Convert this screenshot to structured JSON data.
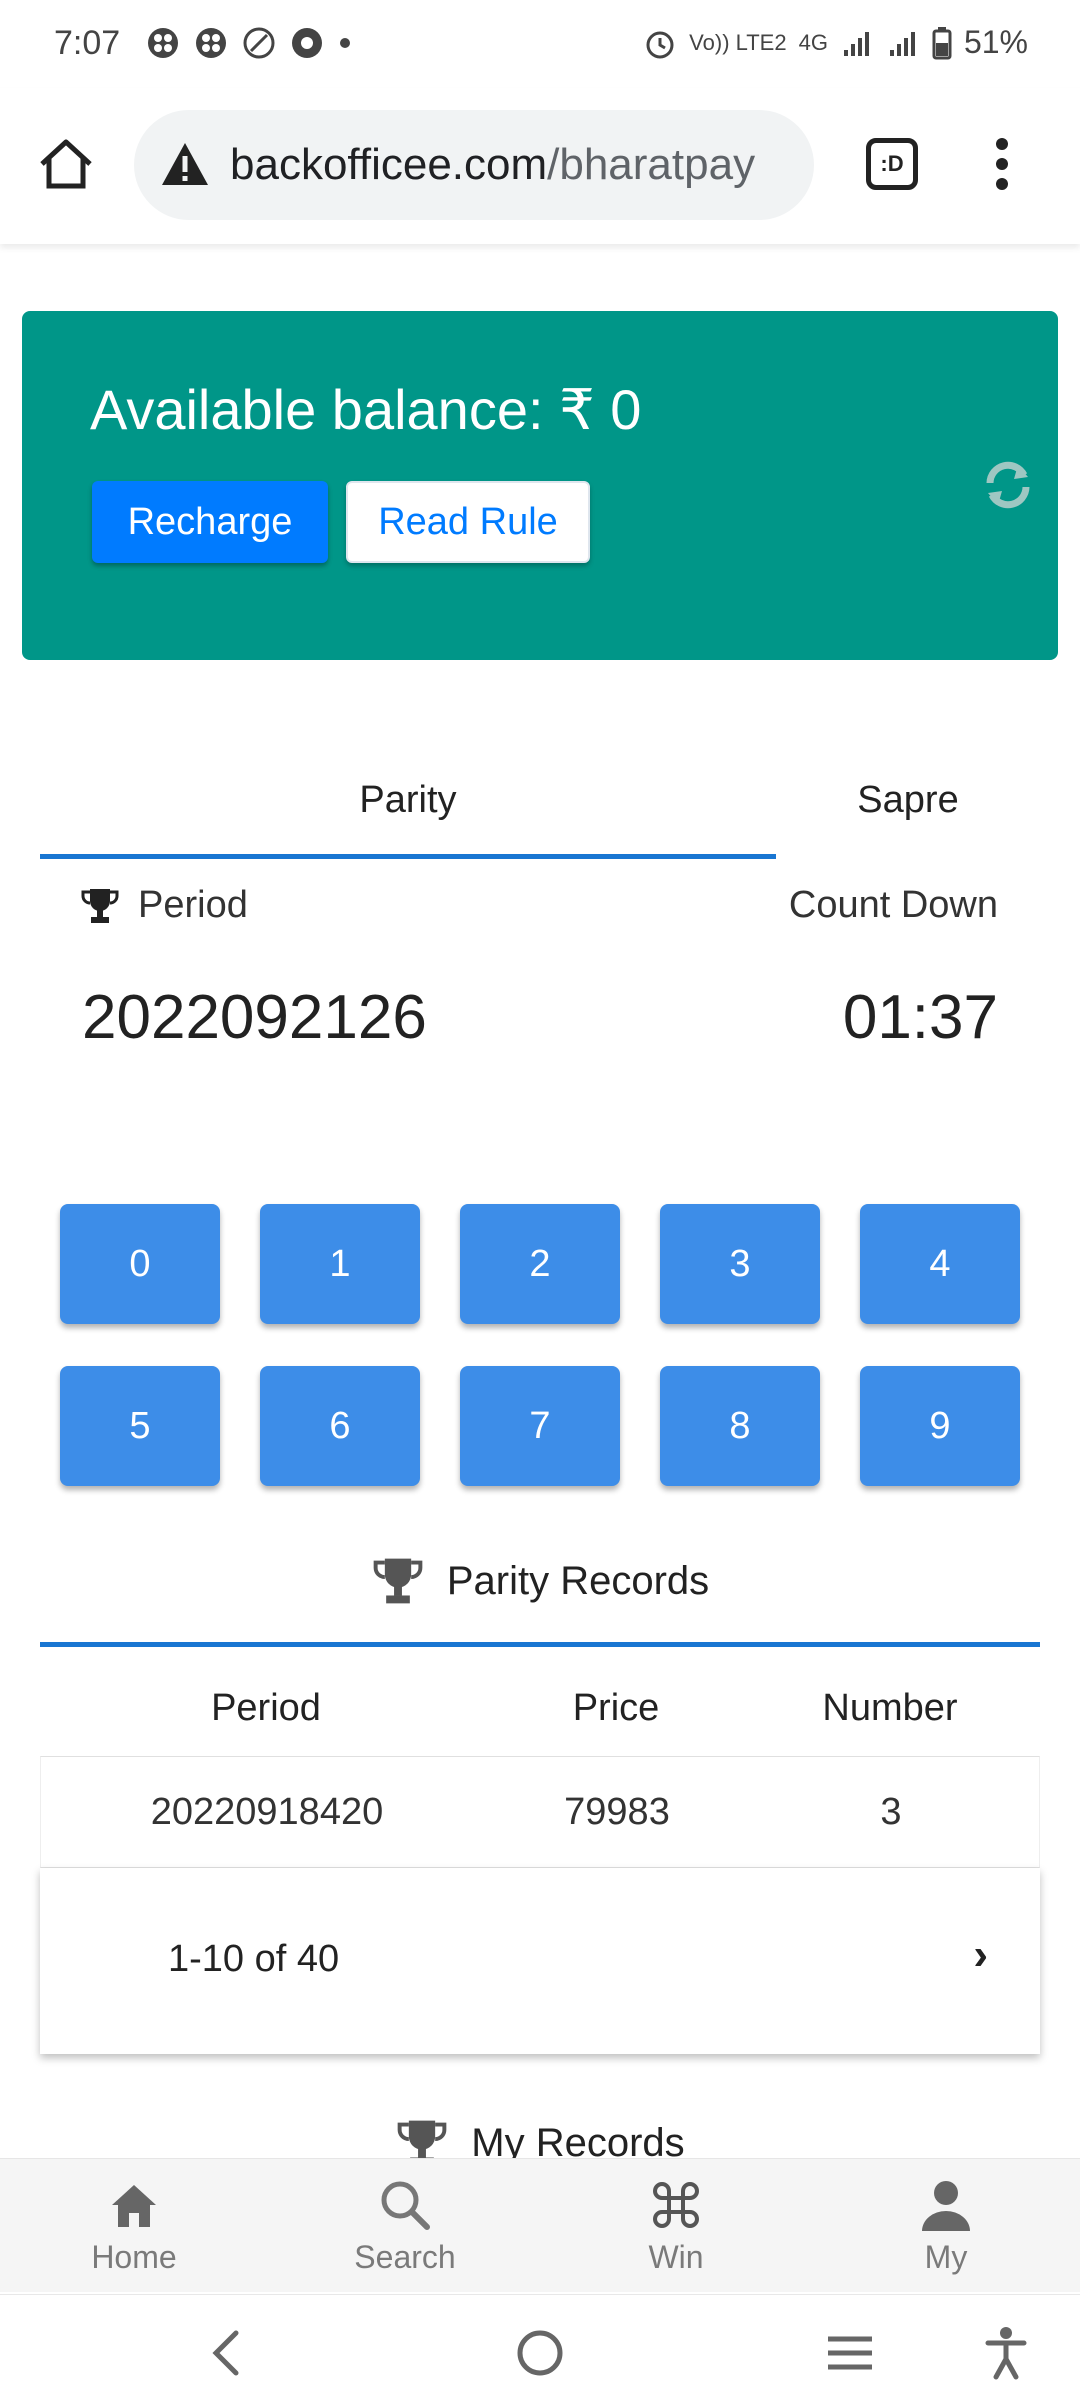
{
  "status_bar": {
    "time": "7:07",
    "network_label": "4G",
    "lte_label": "Vo)) LTE2",
    "battery": "51%"
  },
  "browser": {
    "url_domain": "backofficee.com",
    "url_path": "/bharatpay",
    "tab_switcher_label": ":D"
  },
  "balance": {
    "text": "Available balance: ₹ 0",
    "recharge_label": "Recharge",
    "read_rule_label": "Read Rule",
    "card_color": "#009688"
  },
  "tabs": [
    {
      "label": "Parity",
      "active": true
    },
    {
      "label": "Sapre",
      "active": false
    }
  ],
  "period": {
    "label": "Period",
    "value": "2022092126",
    "countdown_label": "Count Down",
    "countdown_value": "01:37"
  },
  "numbers": [
    "0",
    "1",
    "2",
    "3",
    "4",
    "5",
    "6",
    "7",
    "8",
    "9"
  ],
  "records": {
    "title": "Parity Records",
    "columns": [
      "Period",
      "Price",
      "Number"
    ],
    "rows": [
      [
        "20220918420",
        "79983",
        "3"
      ]
    ],
    "pagination": "1-10 of 40",
    "next_label": "›"
  },
  "my_records": {
    "title": "My Records"
  },
  "bottom_nav": [
    {
      "label": "Home",
      "icon": "home-icon"
    },
    {
      "label": "Search",
      "icon": "search-icon"
    },
    {
      "label": "Win",
      "icon": "command-icon"
    },
    {
      "label": "My",
      "icon": "person-icon"
    }
  ]
}
